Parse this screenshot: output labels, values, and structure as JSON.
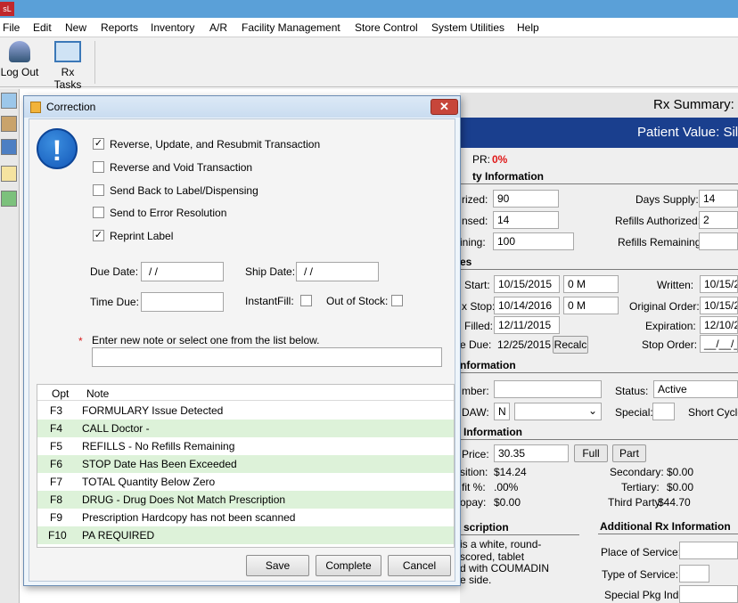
{
  "app": {
    "icon_text": "sL"
  },
  "menu": [
    "File",
    "Edit",
    "New",
    "Reports",
    "Inventory",
    "A/R",
    "Facility Management",
    "Store Control",
    "System Utilities",
    "Help"
  ],
  "toolbar": {
    "logout": "Log Out",
    "rx_tasks": "Rx Tasks"
  },
  "rx": {
    "summary_title": "Rx Summary: #",
    "patient_value": "Patient Value: Silv",
    "pr_label": "PR:",
    "pr_value": "0%",
    "qty_section": "ty Information",
    "authorized_label": "rized:",
    "authorized": "90",
    "dispensed_label": "nsed:",
    "dispensed": "14",
    "remaining_label": "ining:",
    "remaining": "100",
    "days_supply_label": "Days Supply:",
    "days_supply": "14",
    "refills_auth_label": "Refills Authorized:",
    "refills_auth": "2",
    "refills_rem_label": "Refills Remaining:",
    "refills_rem": "",
    "dates_section": "es",
    "start_label": "Start:",
    "start": "10/15/2015",
    "start_time": "0    M",
    "stop_label": "x Stop:",
    "stop": "10/14/2016",
    "stop_time": "0    M",
    "filled_label": "Filled:",
    "filled": "12/11/2015",
    "due_label": "e Due:",
    "due": "12/25/2015",
    "recalc": "Recalc",
    "written_label": "Written:",
    "written": "10/15/2",
    "orig_order_label": "Original Order:",
    "orig_order": "10/15/2",
    "expiration_label": "Expiration:",
    "expiration": "12/10/2",
    "stop_order_label": "Stop Order:",
    "stop_order": "__/__/_",
    "info_section": "nformation",
    "number_label": "mber:",
    "number": "",
    "status_label": "Status:",
    "status": "Active",
    "daw_label": "DAW:",
    "daw": "N",
    "special_label": "Special:",
    "special": "",
    "short_cycle_label": "Short Cycle",
    "price_section": "Information",
    "price_label": "Price:",
    "price": "30.35",
    "full": "Full",
    "part": "Part",
    "acq_label": "sition:",
    "acq": "$14.24",
    "profit_label": "fit %:",
    "profit": ".00%",
    "copay_label": "opay:",
    "copay": "$0.00",
    "secondary_label": "Secondary:",
    "secondary": "$0.00",
    "tertiary_label": "Tertiary:",
    "tertiary": "$0.00",
    "third_party_label": "Third Party:",
    "third_party": "$44.70",
    "desc_section": "scription",
    "desc_lines": [
      "is a white, round-",
      "scored, tablet",
      "d with COUMADIN",
      "e side."
    ],
    "addl_section": "Additional Rx Information",
    "place_label": "Place of Service:",
    "type_label": "Type of Service:",
    "pkg_label": "Special Pkg Ind:"
  },
  "dialog": {
    "title": "Correction",
    "options": [
      {
        "label": "Reverse, Update, and Resubmit Transaction",
        "checked": true
      },
      {
        "label": "Reverse and Void Transaction",
        "checked": false
      },
      {
        "label": "Send Back to Label/Dispensing",
        "checked": false
      },
      {
        "label": "Send to Error Resolution",
        "checked": false
      },
      {
        "label": "Reprint Label",
        "checked": true
      }
    ],
    "due_date_label": "Due Date:",
    "due_date": " / /",
    "ship_date_label": "Ship Date:",
    "ship_date": " / /",
    "time_due_label": "Time Due:",
    "time_due": "",
    "instantfill_label": "InstantFill:",
    "out_of_stock_label": "Out of Stock:",
    "required_mark": "*",
    "note_prompt": "Enter new note or select one from the list below.",
    "note_value": "",
    "grid_headers": {
      "opt": "Opt",
      "note": "Note"
    },
    "notes": [
      {
        "opt": "F3",
        "note": "FORMULARY Issue Detected"
      },
      {
        "opt": "F4",
        "note": "CALL Doctor -"
      },
      {
        "opt": "F5",
        "note": "REFILLS - No Refills Remaining"
      },
      {
        "opt": "F6",
        "note": "STOP Date Has Been Exceeded"
      },
      {
        "opt": "F7",
        "note": "TOTAL Quantity Below Zero"
      },
      {
        "opt": "F8",
        "note": "DRUG - Drug Does Not Match Prescription"
      },
      {
        "opt": "F9",
        "note": "Prescription Hardcopy has not been scanned"
      },
      {
        "opt": "F10",
        "note": "PA REQUIRED"
      }
    ],
    "save": "Save",
    "complete": "Complete",
    "cancel": "Cancel",
    "close_glyph": "✕",
    "info_glyph": "!"
  }
}
